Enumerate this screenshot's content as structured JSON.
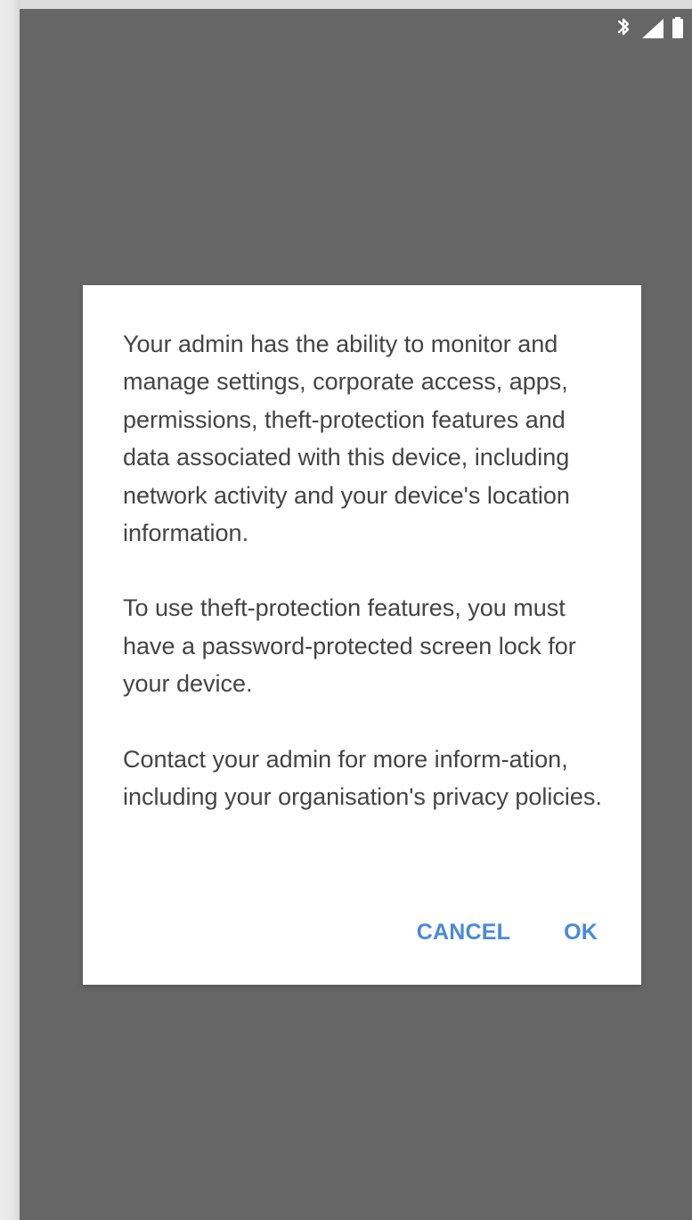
{
  "colors": {
    "screen_background": "#666666",
    "dialog_background": "#ffffff",
    "dialog_text": "#444444",
    "accent": "#4a89dc",
    "status_icons": "#ffffff"
  },
  "status_bar": {
    "icons": [
      "bluetooth-icon",
      "cellular-signal-icon",
      "battery-icon"
    ]
  },
  "dialog": {
    "paragraphs": [
      "Your admin has the ability to monitor and manage settings, corporate access, apps, permissions, theft-protection features and data associated with this device, including network activity and your device's location information.",
      "To use theft-protection features, you must have a password-protected screen lock for your device.",
      "Contact your admin for more inform-ation, including your organisation's privacy policies."
    ],
    "actions": {
      "cancel_label": "CANCEL",
      "ok_label": "OK"
    }
  }
}
